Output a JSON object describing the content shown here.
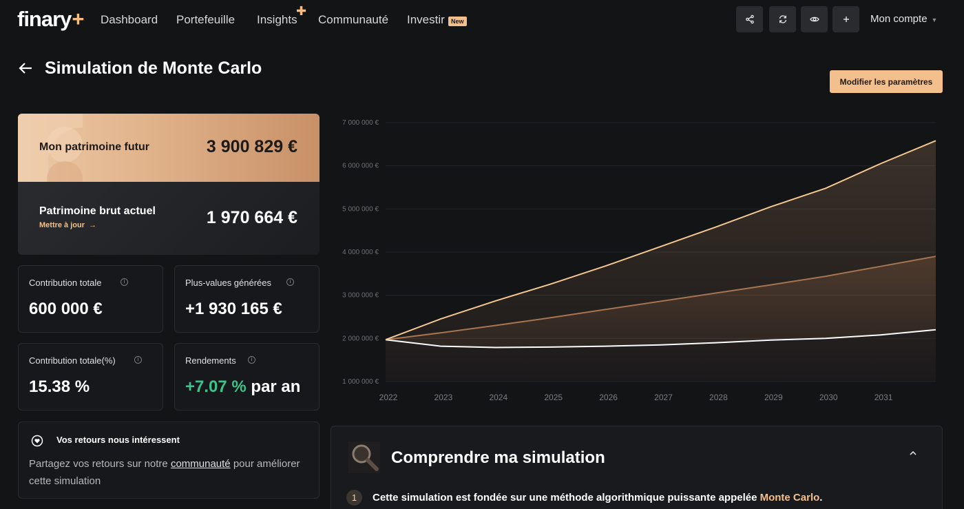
{
  "nav": {
    "logo": "finary",
    "logo_plus": "+",
    "items": [
      "Dashboard",
      "Portefeuille",
      "Insights",
      "Communauté",
      "Investir"
    ],
    "new_badge": "New",
    "account": "Mon compte",
    "icons": [
      "share-icon",
      "refresh-icon",
      "eye-icon",
      "plus-icon"
    ]
  },
  "header": {
    "title": "Simulation de Monte Carlo",
    "params_button": "Modifier les paramètres"
  },
  "future": {
    "label": "Mon patrimoine futur",
    "value": "3 900 829 €",
    "gross_label": "Patrimoine brut actuel",
    "update_link": "Mettre à jour",
    "gross_value": "1 970 664 €"
  },
  "stats": {
    "contribution": {
      "label": "Contribution totale",
      "value": "600 000 €"
    },
    "gains": {
      "label": "Plus-values générées",
      "value": "+1 930 165 €"
    },
    "contribution_pct": {
      "label": "Contribution totale(%)",
      "value": "15.38 %"
    },
    "returns": {
      "label": "Rendements",
      "value": "+7.07 %",
      "suffix": "par an"
    }
  },
  "feedback": {
    "title": "Vos retours nous intéressent",
    "text_before": "Partagez vos retours sur notre ",
    "link": "communauté",
    "text_after": " pour améliorer cette simulation"
  },
  "understand": {
    "title": "Comprendre ma simulation",
    "step_number": "1",
    "step_text": "Cette simulation est fondée sur une méthode algorithmique puissante appelée ",
    "step_highlight": "Monte Carlo",
    "step_end": "."
  },
  "colors": {
    "accent": "#f3c08d",
    "green": "#3cc48a",
    "optimistic": "#f5c791",
    "median": "#a77552",
    "pessimistic": "#ffffff"
  },
  "chart_data": {
    "type": "area",
    "x": [
      2022,
      2023,
      2024,
      2025,
      2026,
      2027,
      2028,
      2029,
      2030,
      2031,
      2032
    ],
    "x_tick_labels": [
      "2022",
      "2023",
      "2024",
      "2025",
      "2026",
      "2027",
      "2028",
      "2029",
      "2030",
      "2031"
    ],
    "y_tick_labels": [
      "1 000 000 €",
      "2 000 000 €",
      "3 000 000 €",
      "4 000 000 €",
      "5 000 000 €",
      "6 000 000 €",
      "7 000 000 €"
    ],
    "ylim": [
      1000000,
      7000000
    ],
    "grid": true,
    "series": [
      {
        "values": [
          1970664,
          2450000,
          2870000,
          3260000,
          3680000,
          4130000,
          4580000,
          5050000,
          5480000,
          6050000,
          6580000
        ],
        "color": "#f5c791"
      },
      {
        "values": [
          1970664,
          2130000,
          2300000,
          2480000,
          2670000,
          2860000,
          3050000,
          3240000,
          3440000,
          3670000,
          3900829
        ],
        "color": "#a77552"
      },
      {
        "values": [
          1970664,
          1820000,
          1790000,
          1800000,
          1820000,
          1850000,
          1900000,
          1960000,
          2000000,
          2080000,
          2200000
        ],
        "color": "#ffffff"
      }
    ]
  }
}
